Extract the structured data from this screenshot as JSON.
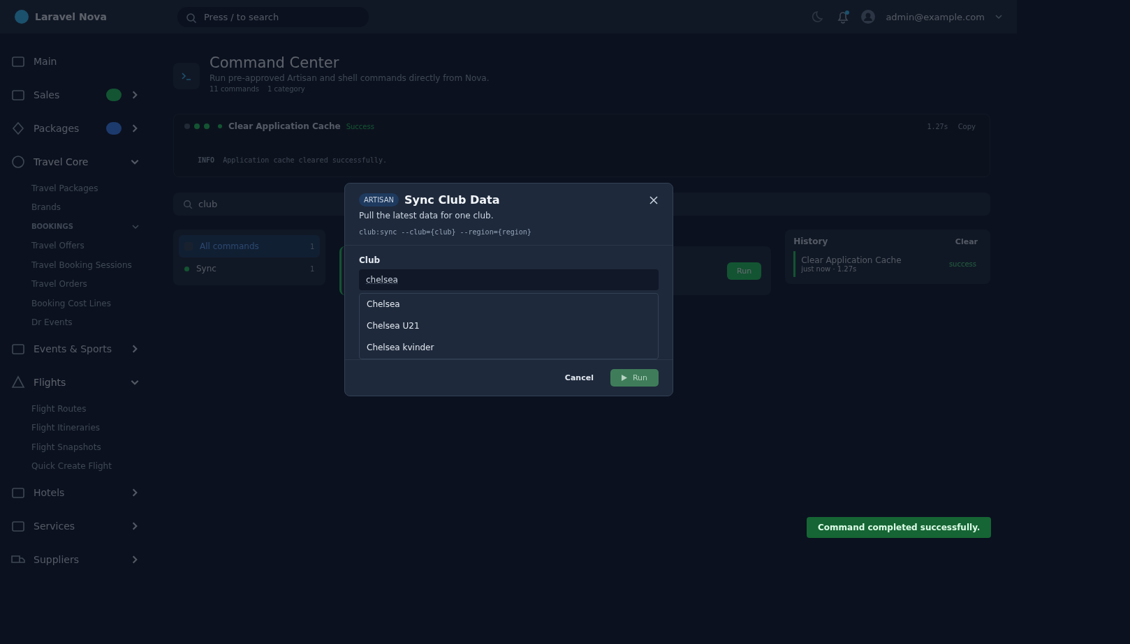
{
  "app": {
    "brand": "Laravel Nova",
    "search_placeholder": "Press / to search",
    "user": "admin@example.com"
  },
  "sidebar": {
    "items": [
      {
        "label": "Main"
      },
      {
        "label": "Sales",
        "color": "#135433",
        "expanded": false
      },
      {
        "label": "Packages",
        "color": "#1d3a6c",
        "expanded": false
      },
      {
        "label": "Travel Core",
        "expanded": true,
        "children": [
          {
            "label": "Travel Packages"
          },
          {
            "label": "Brands"
          },
          {
            "label": "BOOKINGS",
            "kind": "group",
            "expanded": true
          },
          {
            "label": "Travel Offers"
          },
          {
            "label": "Travel Booking Sessions"
          },
          {
            "label": "Travel Orders"
          },
          {
            "label": "Booking Cost Lines"
          },
          {
            "label": "Dr Events"
          }
        ]
      },
      {
        "label": "Events & Sports",
        "expanded": false
      },
      {
        "label": "Flights",
        "expanded": true,
        "children": [
          {
            "label": "Flight Routes"
          },
          {
            "label": "Flight Itineraries"
          },
          {
            "label": "Flight Snapshots"
          },
          {
            "label": "Quick Create Flight"
          }
        ]
      },
      {
        "label": "Hotels",
        "expanded": false
      },
      {
        "label": "Services",
        "expanded": false
      },
      {
        "label": "Suppliers",
        "expanded": false
      }
    ]
  },
  "page": {
    "title": "Command Center",
    "subtitle": "Run pre-approved Artisan and shell commands directly from Nova.",
    "stats": [
      "11 commands",
      "1 category"
    ]
  },
  "output": {
    "command": "Clear Application Cache",
    "status": "Success",
    "duration": "1.27s",
    "copy": "Copy",
    "lines": [
      {
        "tag": "INFO",
        "text": "Application cache cleared successfully."
      }
    ]
  },
  "filter": {
    "value": "club"
  },
  "categories": [
    {
      "label": "All commands",
      "count": "1",
      "selected": true
    },
    {
      "label": "Sync",
      "count": "1",
      "selected": false
    }
  ],
  "command_card": {
    "run": "Run"
  },
  "history": {
    "title": "History",
    "clear": "Clear",
    "items": [
      {
        "name": "Clear Application Cache",
        "meta": "just now · 1.27s",
        "status": "success"
      }
    ]
  },
  "modal": {
    "tag": "ARTISAN",
    "title": "Sync Club Data",
    "description": "Pull the latest data for one club.",
    "signature": "club:sync --club={club} --region={region}",
    "field": {
      "label": "Club",
      "value": "chelsea"
    },
    "options": [
      {
        "label": "Chelsea",
        "selected": false
      },
      {
        "label": "Chelsea U21",
        "selected": false
      },
      {
        "label": "Chelsea kvinder",
        "selected": false
      }
    ],
    "cancel": "Cancel",
    "run": "Run",
    "run_disabled": true
  },
  "toast": {
    "text": "Command completed successfully."
  }
}
